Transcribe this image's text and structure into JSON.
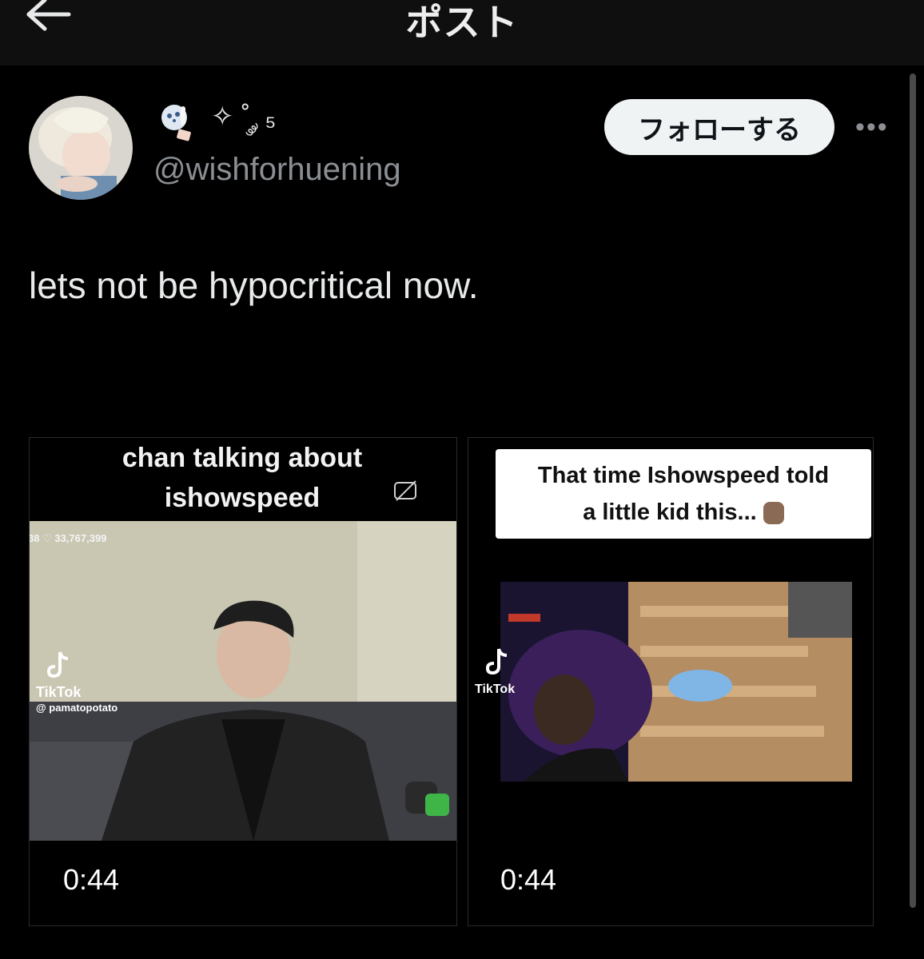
{
  "header": {
    "title": "ポスト",
    "back_icon": "arrow-left-icon"
  },
  "author": {
    "display_name_suffix": "✧ ˚ ༘ ₅",
    "handle": "@wishforhuening",
    "follow_label": "フォローする",
    "more_label": "•••"
  },
  "post": {
    "text": "lets not be hypocritical now."
  },
  "media": [
    {
      "caption_line1": "chan talking about",
      "caption_line2": "ishowspeed",
      "stats": "38 ♡ 33,767,399",
      "watermark_brand": "TikTok",
      "watermark_user": "@ pamatopotato",
      "duration": "0:44"
    },
    {
      "caption_line1": "That time Ishowspeed told",
      "caption_line2": "a little kid this...",
      "watermark_brand": "TikTok",
      "duration": "0:44"
    }
  ],
  "colors": {
    "background": "#000000",
    "follow_button_bg": "#eff3f4",
    "muted_text": "#8b8f93"
  }
}
